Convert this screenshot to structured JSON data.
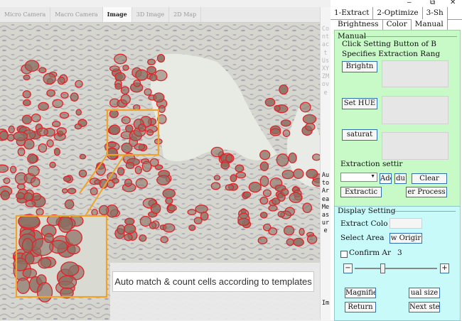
{
  "view_tabs": [
    "Micro Camera",
    "Macro Camera",
    "Image",
    "3D Image",
    "2D Map"
  ],
  "active_view_tab": 2,
  "caption": "Auto match & count cells according to templates",
  "vertical_strip": {
    "light_text": "Contact Us XYZMove",
    "dark_text": "Auto Area Measure",
    "bottom_text": "Im"
  },
  "window_buttons": [
    "–",
    "⧉",
    "✕"
  ],
  "main_tabs": [
    "1-Extract",
    "2-Optimize",
    "3-Sh"
  ],
  "sub_tabs": [
    "Brightness",
    "Color",
    "Manual"
  ],
  "manual": {
    "group_label": "Manual",
    "line1": "Click Setting Button of B",
    "line2": "Specifies Extraction Rang",
    "brightness_btn": "Brightn",
    "hue_btn": "Set HUE",
    "saturation_btn": "saturat",
    "extraction_label": "Extraction settir",
    "add_btn": "Adc",
    "du_btn": "du",
    "clear_btn": "Clear",
    "extraction_btn": "Extractic",
    "process_btn": "er Process"
  },
  "display": {
    "group_label": "Display Setting",
    "extract_color_label": "Extract Colo",
    "select_area_label": "Select Area",
    "show_original_btn": "w Origir",
    "confirm_label": "Confirm Ar",
    "confirm_value": "3",
    "minus_btn": "−",
    "plus_btn": "+",
    "magnifier_btn": "Magnifie",
    "actual_size_btn": "ual size",
    "return_btn": "Return",
    "next_step_btn": "Next ste"
  },
  "colors": {
    "cell_outline": "#e0242a",
    "cell_fill": "#8a6f62",
    "zoom_box": "#f0a22a",
    "manual_bg": "#c8fac8",
    "display_bg": "#c8fafa",
    "button_border": "#2b6fb0"
  }
}
